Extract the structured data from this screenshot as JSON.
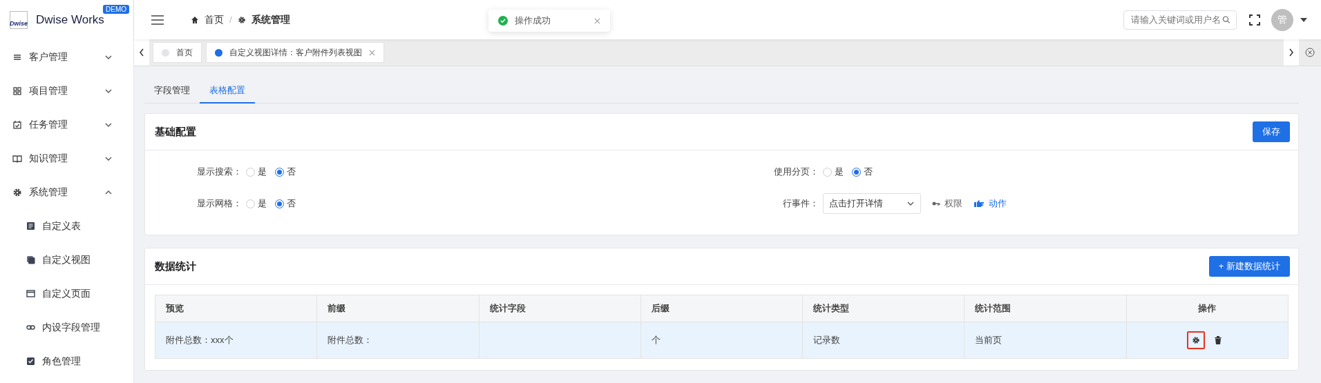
{
  "logo": {
    "mark": "Dwise",
    "title": "Dwise Works",
    "badge": "DEMO"
  },
  "sidebar": {
    "items": [
      {
        "label": "客户管理",
        "expanded": false
      },
      {
        "label": "项目管理",
        "expanded": false
      },
      {
        "label": "任务管理",
        "expanded": false
      },
      {
        "label": "知识管理",
        "expanded": false
      },
      {
        "label": "系统管理",
        "expanded": true,
        "children": [
          {
            "label": "自定义表"
          },
          {
            "label": "自定义视图"
          },
          {
            "label": "自定义页面"
          },
          {
            "label": "内设字段管理"
          },
          {
            "label": "角色管理"
          }
        ]
      }
    ]
  },
  "header": {
    "breadcrumb": [
      "首页",
      "系统管理"
    ],
    "breadcrumb_separator": "/",
    "search": {
      "placeholder": "请输入关键词或用户名"
    },
    "avatar": "管"
  },
  "toast": {
    "message": "操作成功"
  },
  "open_tabs": [
    {
      "label": "首页",
      "selected": false
    },
    {
      "label": "自定义视图详情：客户附件列表视图",
      "selected": true
    }
  ],
  "page_tabs": [
    {
      "label": "字段管理",
      "selected": false
    },
    {
      "label": "表格配置",
      "selected": true
    }
  ],
  "basic_config": {
    "title": "基础配置",
    "save_button": "保存",
    "fields": [
      {
        "kind": "radio",
        "label": "显示搜索：",
        "options": [
          {
            "label": "是",
            "selected": false
          },
          {
            "label": "否",
            "selected": true
          }
        ]
      },
      {
        "kind": "radio",
        "label": "使用分页：",
        "options": [
          {
            "label": "是",
            "selected": false
          },
          {
            "label": "否",
            "selected": true
          }
        ]
      },
      {
        "kind": "radio",
        "label": "显示网格：",
        "options": [
          {
            "label": "是",
            "selected": false
          },
          {
            "label": "否",
            "selected": true
          }
        ]
      },
      {
        "kind": "select",
        "label": "行事件：",
        "value": "点击打开详情",
        "links": [
          {
            "kind": "key",
            "label": "权限"
          },
          {
            "kind": "action",
            "label": "动作"
          }
        ]
      }
    ]
  },
  "data_stats": {
    "title": "数据统计",
    "new_button": "+ 新建数据统计",
    "table": {
      "columns": [
        "预览",
        "前缀",
        "统计字段",
        "后缀",
        "统计类型",
        "统计范围",
        "操作"
      ],
      "rows": [
        {
          "selected": true,
          "cells": [
            "附件总数：xxx个",
            "附件总数：",
            "",
            "个",
            "记录数",
            "当前页"
          ],
          "actions": [
            {
              "kind": "settings",
              "focused": true
            },
            {
              "kind": "delete",
              "focused": false
            }
          ]
        }
      ]
    }
  }
}
